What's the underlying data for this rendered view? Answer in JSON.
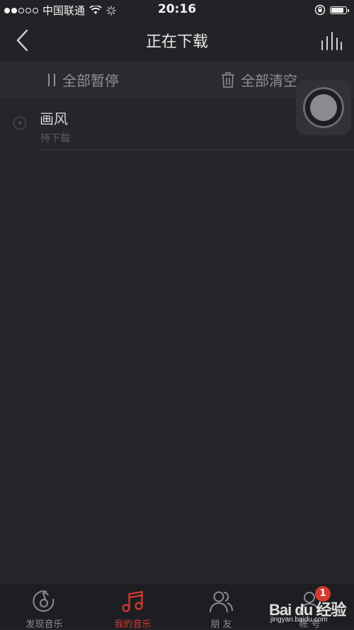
{
  "status_bar": {
    "carrier": "中国联通",
    "time": "20:16",
    "battery_level": 0.9
  },
  "nav": {
    "title": "正在下载"
  },
  "toolbar": {
    "pause_all": "全部暂停",
    "clear_all": "全部清空"
  },
  "downloads": [
    {
      "title": "画风",
      "status": "待下载"
    }
  ],
  "tabs": [
    {
      "label": "发现音乐",
      "icon": "discover-music-icon",
      "active": false
    },
    {
      "label": "我的音乐",
      "icon": "music-note-icon",
      "active": true
    },
    {
      "label": "朋 友",
      "icon": "friends-icon",
      "active": false
    },
    {
      "label": "帐 号",
      "icon": "account-icon",
      "active": false,
      "badge": "1"
    }
  ],
  "watermark": {
    "brand": "Bai du 经验",
    "url": "jingyan.baidu.com"
  },
  "colors": {
    "background": "#25252a",
    "accent": "#d33a31",
    "text_primary": "#d4d4d6",
    "text_secondary": "#5e5e63"
  }
}
